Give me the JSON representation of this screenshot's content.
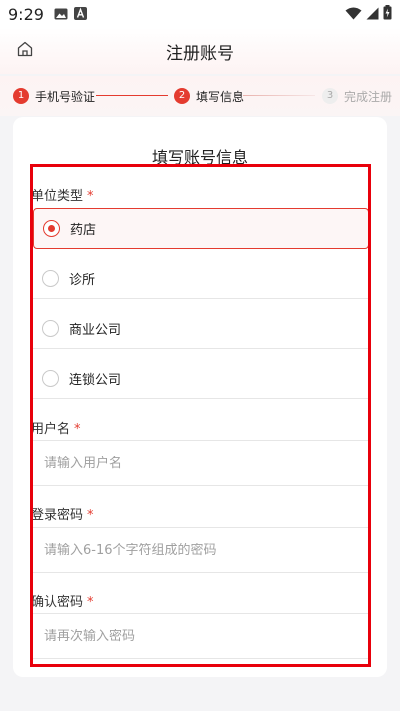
{
  "status_bar": {
    "time": "9:29"
  },
  "header": {
    "title": "注册账号"
  },
  "stepper": {
    "steps": [
      {
        "num": "1",
        "label": "手机号验证"
      },
      {
        "num": "2",
        "label": "填写信息"
      },
      {
        "num": "3",
        "label": "完成注册"
      }
    ]
  },
  "form": {
    "title": "填写账号信息",
    "unit_type": {
      "label": "单位类型",
      "required_mark": "*",
      "options": [
        {
          "label": "药店",
          "selected": true
        },
        {
          "label": "诊所",
          "selected": false
        },
        {
          "label": "商业公司",
          "selected": false
        },
        {
          "label": "连锁公司",
          "selected": false
        }
      ]
    },
    "username": {
      "label": "用户名",
      "required_mark": "*",
      "placeholder": "请输入用户名",
      "value": ""
    },
    "password": {
      "label": "登录密码",
      "required_mark": "*",
      "placeholder": "请输入6-16个字符组成的密码",
      "value": ""
    },
    "confirm_password": {
      "label": "确认密码",
      "required_mark": "*",
      "placeholder": "请再次输入密码",
      "value": ""
    }
  },
  "colors": {
    "accent": "#e43b2f",
    "highlight_frame": "#e8000b",
    "page_background": "#f4f4f6"
  },
  "icons": {
    "status_left": [
      "image-icon",
      "a-letter-icon"
    ],
    "status_right": [
      "wifi-icon",
      "signal-icon",
      "battery-charging-icon"
    ],
    "header_left": "home-icon"
  }
}
